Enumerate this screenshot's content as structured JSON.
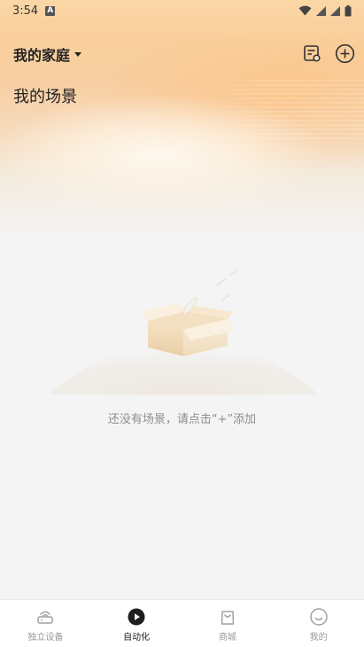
{
  "status_bar": {
    "time": "3:54",
    "notification_icon": "a-letter-icon",
    "indicators": [
      "wifi-icon",
      "signal-icon",
      "signal-icon",
      "battery-icon"
    ]
  },
  "header": {
    "home_name": "我的家庭",
    "dropdown_icon": "caret-down-icon",
    "actions": [
      "log-list-icon",
      "add-circle-icon"
    ]
  },
  "page": {
    "title": "我的场景"
  },
  "empty_state": {
    "illustration": "open-box-icon",
    "message": "还没有场景，请点击“+”添加"
  },
  "tab_bar": {
    "tabs": [
      {
        "label": "独立设备",
        "icon": "router-device-icon",
        "active": false
      },
      {
        "label": "自动化",
        "icon": "play-circle-icon",
        "active": true
      },
      {
        "label": "商城",
        "icon": "shopping-bag-icon",
        "active": false
      },
      {
        "label": "我的",
        "icon": "smile-face-icon",
        "active": false
      }
    ]
  },
  "colors": {
    "header_gradient_top": "#fbd6a6",
    "page_background": "#f4f4f4",
    "tab_active": "#222222",
    "tab_inactive": "#999999",
    "empty_text": "#8e8e8e"
  }
}
